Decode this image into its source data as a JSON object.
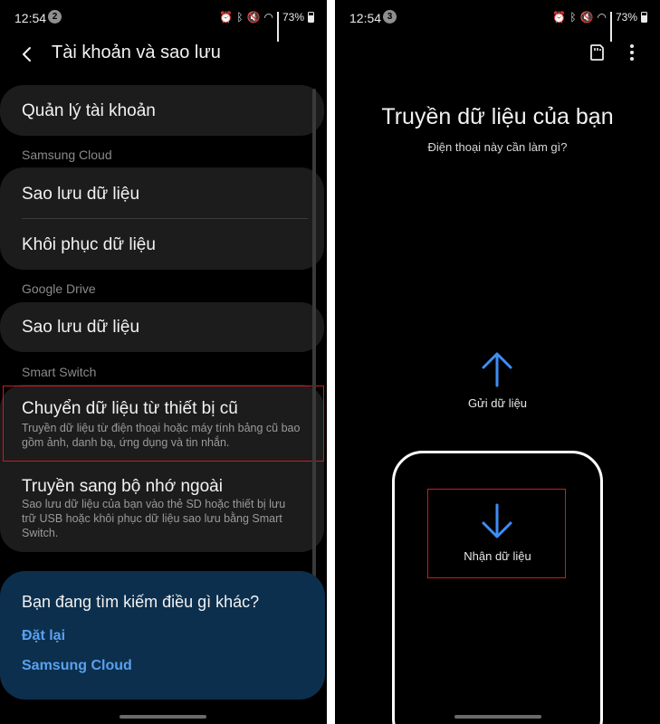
{
  "left": {
    "status": {
      "time": "12:54",
      "badge": "2",
      "battery": "73%"
    },
    "title": "Tài khoản và sao lưu",
    "manage_accounts": "Quản lý tài khoản",
    "samsung_cloud": {
      "label": "Samsung Cloud",
      "backup": "Sao lưu dữ liệu",
      "restore": "Khôi phục dữ liệu"
    },
    "google_drive": {
      "label": "Google Drive",
      "backup": "Sao lưu dữ liệu"
    },
    "smart_switch": {
      "label": "Smart Switch",
      "transfer_title": "Chuyển dữ liệu từ thiết bị cũ",
      "transfer_desc": "Truyền dữ liệu từ điện thoại hoặc máy tính bảng cũ bao gồm ảnh, danh bạ, ứng dụng và tin nhắn.",
      "external_title": "Truyền sang bộ nhớ ngoài",
      "external_desc": "Sao lưu dữ liệu của bạn vào thẻ SD hoặc thiết bị lưu trữ USB hoặc khôi phục dữ liệu sao lưu bằng Smart Switch."
    },
    "search_more": {
      "title": "Bạn đang tìm kiếm điều gì khác?",
      "link_reset": "Đặt lại",
      "link_cloud": "Samsung Cloud"
    }
  },
  "right": {
    "status": {
      "time": "12:54",
      "badge": "3",
      "battery": "73%"
    },
    "title": "Truyền dữ liệu của bạn",
    "subtitle": "Điện thoại này cần làm gì?",
    "send_label": "Gửi dữ liệu",
    "receive_label": "Nhận dữ liệu"
  },
  "colors": {
    "accent": "#3e8ef7",
    "link": "#5aa0ee",
    "highlight": "#d11a1a",
    "card": "#1c1c1c",
    "search_card": "#0c2f4d"
  }
}
